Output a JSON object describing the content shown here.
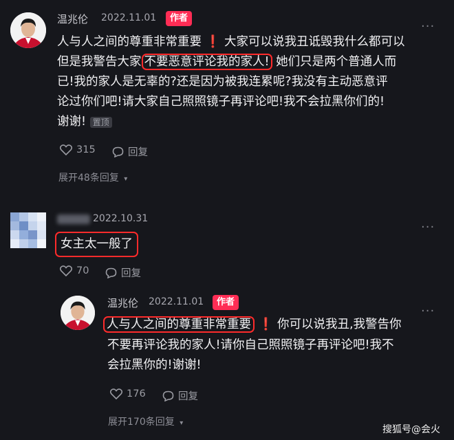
{
  "comment1": {
    "name": "温兆伦",
    "date": "2022.11.01",
    "badge": "作者",
    "more": "···",
    "line1_a": "人与人之间的尊重非常重要",
    "line1_b": "大家可以说我丑诋毁我什么都可以",
    "line2_a": "但是我警告大家",
    "line2_hl": "不要恶意评论我的家人!",
    "line2_b": "她们只是两个普通人而",
    "line3": "已!我的家人是无辜的?还是因为被我连累呢?我没有主动恶意评",
    "line4": "论过你们吧!请大家自己照照镜子再评论吧!我不会拉黑你们的!",
    "line5": "谢谢!",
    "pinned": "置顶",
    "likes": "315",
    "reply": "回复",
    "expand": "展开48条回复"
  },
  "comment2": {
    "date": "2022.10.31",
    "more": "···",
    "text": "女主太一般了",
    "likes": "70",
    "reply": "回复"
  },
  "comment3": {
    "name": "温兆伦",
    "date": "2022.11.01",
    "badge": "作者",
    "more": "···",
    "line1_hl": "人与人之间的尊重非常重要",
    "line1_b": "你可以说我丑,我警告你",
    "line2": "不要再评论我的家人!请你自己照照镜子再评论吧!我不",
    "line3": "会拉黑你的!谢谢!",
    "likes": "176",
    "reply": "回复",
    "expand": "展开170条回复"
  },
  "watermark": "搜狐号@会火",
  "colors": {
    "background": "#16171c",
    "author_badge": "#ff2d55",
    "highlight_box": "#ff2b2b"
  }
}
